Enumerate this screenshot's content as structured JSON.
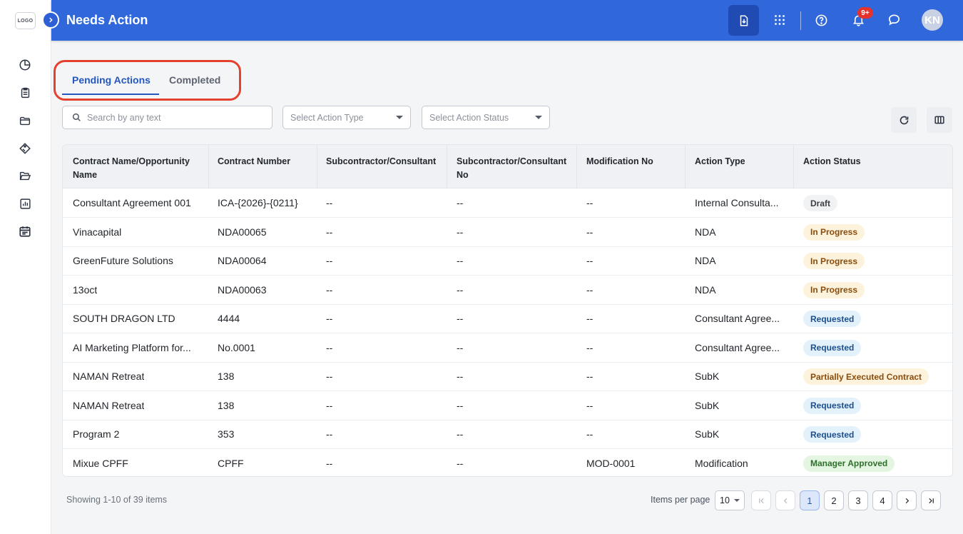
{
  "header": {
    "title": "Needs Action",
    "notification_count": "9+",
    "avatar_initials": "KN"
  },
  "sidebar": {
    "logo_text": "LOGO",
    "items": [
      {
        "icon": "pie-chart-icon"
      },
      {
        "icon": "clipboard-icon"
      },
      {
        "icon": "folder-icon"
      },
      {
        "icon": "tag-icon"
      },
      {
        "icon": "folder-open-icon"
      },
      {
        "icon": "bar-chart-icon"
      },
      {
        "icon": "calendar-icon"
      }
    ]
  },
  "tabs": {
    "pending": "Pending Actions",
    "completed": "Completed",
    "active": "Pending Actions"
  },
  "filters": {
    "search_placeholder": "Search by any text",
    "action_type_placeholder": "Select Action Type",
    "action_status_placeholder": "Select Action Status"
  },
  "table": {
    "columns": {
      "contract_name": "Contract Name/Opportunity Name",
      "contract_number": "Contract Number",
      "subcontractor": "Subcontractor/Consultant",
      "subcontractor_no": "Subcontractor/Consultant No",
      "modification_no": "Modification No",
      "action_type": "Action Type",
      "action_status": "Action Status"
    },
    "rows": [
      {
        "name": "Consultant Agreement 001",
        "number": "ICA-{2026}-{0211}",
        "sub": "--",
        "sub_no": "--",
        "mod": "--",
        "type": "Internal Consulta...",
        "status": "Draft"
      },
      {
        "name": "Vinacapital",
        "number": "NDA00065",
        "sub": "--",
        "sub_no": "--",
        "mod": "--",
        "type": "NDA",
        "status": "In Progress"
      },
      {
        "name": "GreenFuture Solutions",
        "number": "NDA00064",
        "sub": "--",
        "sub_no": "--",
        "mod": "--",
        "type": "NDA",
        "status": "In Progress"
      },
      {
        "name": "13oct",
        "number": "NDA00063",
        "sub": "--",
        "sub_no": "--",
        "mod": "--",
        "type": "NDA",
        "status": "In Progress"
      },
      {
        "name": "SOUTH DRAGON LTD",
        "number": "4444",
        "sub": "--",
        "sub_no": "--",
        "mod": "--",
        "type": "Consultant Agree...",
        "status": "Requested"
      },
      {
        "name": "AI Marketing Platform for...",
        "number": "No.0001",
        "sub": "--",
        "sub_no": "--",
        "mod": "--",
        "type": "Consultant Agree...",
        "status": "Requested"
      },
      {
        "name": "NAMAN Retreat",
        "number": "138",
        "sub": "--",
        "sub_no": "--",
        "mod": "--",
        "type": "SubK",
        "status": "Partially Executed Contract"
      },
      {
        "name": "NAMAN Retreat",
        "number": "138",
        "sub": "--",
        "sub_no": "--",
        "mod": "--",
        "type": "SubK",
        "status": "Requested"
      },
      {
        "name": "Program 2",
        "number": "353",
        "sub": "--",
        "sub_no": "--",
        "mod": "--",
        "type": "SubK",
        "status": "Requested"
      },
      {
        "name": "Mixue CPFF",
        "number": "CPFF",
        "sub": "--",
        "sub_no": "--",
        "mod": "MOD-0001",
        "type": "Modification",
        "status": "Manager Approved"
      }
    ]
  },
  "status_colors": {
    "Draft": {
      "bg": "#f1f2f4",
      "fg": "#3a3f47"
    },
    "In Progress": {
      "bg": "#fdf3dc",
      "fg": "#8a4b0b"
    },
    "Requested": {
      "bg": "#e3f1fb",
      "fg": "#1c4f8f"
    },
    "Partially Executed Contract": {
      "bg": "#fdf3dc",
      "fg": "#8a4b0b"
    },
    "Manager Approved": {
      "bg": "#e4f5e2",
      "fg": "#2e6f2a"
    }
  },
  "footer": {
    "showing": "Showing 1-10 of 39 items",
    "items_per_page_label": "Items per page",
    "items_per_page": "10",
    "pages": [
      "1",
      "2",
      "3",
      "4"
    ],
    "current_page": "1"
  },
  "colors": {
    "header": "#3068db",
    "accent": "#2357c2",
    "highlight_outline": "#e4412f"
  }
}
